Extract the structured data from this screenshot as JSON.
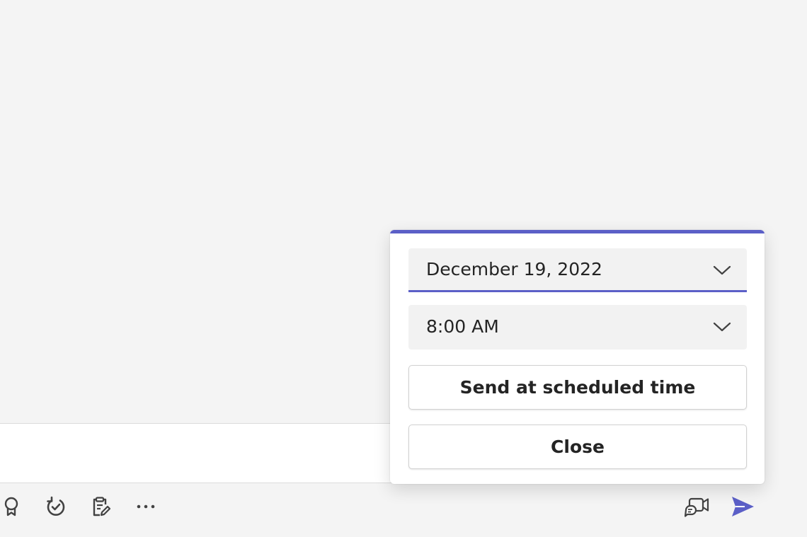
{
  "schedule_popup": {
    "accent_color": "#5b5fc7",
    "date_value": "December 19, 2022",
    "time_value": "8:00 AM",
    "send_button_label": "Send at scheduled time",
    "close_button_label": "Close"
  },
  "toolbar": {
    "left_icons": [
      "praise-icon",
      "loop-icon",
      "clipboard-edit-icon",
      "more-options-icon"
    ],
    "right_icons": [
      "meet-now-icon",
      "send-icon"
    ],
    "send_color": "#5b5fc7"
  }
}
